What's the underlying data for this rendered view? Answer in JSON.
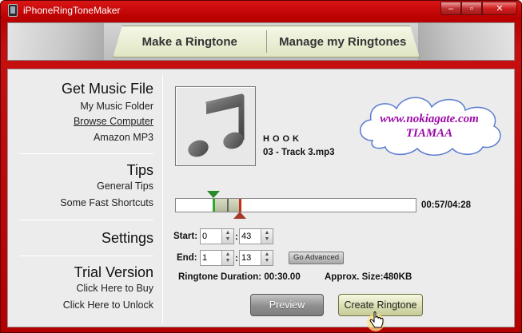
{
  "window": {
    "title": "iPhoneRingToneMaker",
    "minimize_glyph": "–",
    "maximize_glyph": "▫",
    "close_glyph": "✕"
  },
  "tabs": [
    {
      "label": "Make a Ringtone"
    },
    {
      "label": "Manage my Ringtones"
    }
  ],
  "sidebar": {
    "sections": [
      {
        "heading": "Get Music File",
        "links": [
          "My Music Folder",
          "Browse Computer",
          "Amazon MP3"
        ]
      },
      {
        "heading": "Tips",
        "links": [
          "General Tips",
          "Some Fast Shortcuts"
        ]
      },
      {
        "heading": "Settings",
        "links": []
      },
      {
        "heading": "Trial Version",
        "links": [
          "Click Here to Buy",
          "Click Here to Unlock"
        ]
      }
    ]
  },
  "track": {
    "title": "HOOK",
    "file": "03 - Track 3.mp3",
    "album_art_icon": "music-note-icon"
  },
  "watermark": {
    "line1": "www.nokiagate.com",
    "line2": "TIAMAA"
  },
  "timeline": {
    "time_display": "00:57/04:28",
    "start_fraction": 0.156,
    "end_fraction": 0.267,
    "playhead_fraction": 0.214
  },
  "start": {
    "label": "Start:",
    "minutes": "0",
    "seconds": "43"
  },
  "end": {
    "label": "End:",
    "minutes": "1",
    "seconds": "13"
  },
  "colon": ":",
  "go_advanced_label": "Go Advanced",
  "info": {
    "duration": "Ringtone Duration: 00:30.00",
    "size": "Approx. Size:480KB"
  },
  "buttons": {
    "preview": "Preview",
    "create": "Create Ringtone"
  },
  "colors": {
    "frame": "#c00000",
    "watermark_text": "#9b0aa8",
    "start_marker": "#2a8a2a",
    "end_marker": "#c0301c"
  }
}
